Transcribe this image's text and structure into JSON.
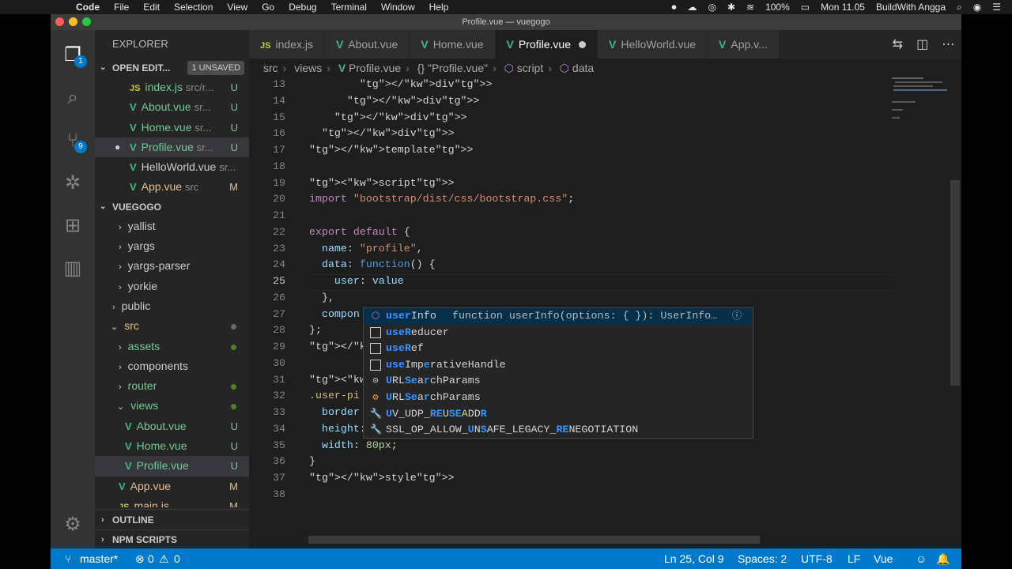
{
  "mac_menu": {
    "apple": "",
    "app_name": "Code",
    "items": [
      "File",
      "Edit",
      "Selection",
      "View",
      "Go",
      "Debug",
      "Terminal",
      "Window",
      "Help"
    ],
    "battery": "100%",
    "clock": "Mon 11.05",
    "user": "BuildWith Angga"
  },
  "window": {
    "title": "Profile.vue — vuegogo"
  },
  "activity_bar": {
    "explorer_badge": "1",
    "scm_badge": "9"
  },
  "sidebar": {
    "title": "EXPLORER",
    "open_editors": {
      "label": "OPEN EDIT...",
      "unsaved": "1 UNSAVED",
      "items": [
        {
          "icon": "JS",
          "name": "index.js",
          "path": "src/r...",
          "status": "U"
        },
        {
          "icon": "V",
          "name": "About.vue",
          "path": "sr...",
          "status": "U"
        },
        {
          "icon": "V",
          "name": "Home.vue",
          "path": "sr...",
          "status": "U"
        },
        {
          "icon": "V",
          "name": "Profile.vue",
          "path": "sr...",
          "status": "U"
        },
        {
          "icon": "V",
          "name": "HelloWorld.vue",
          "path": "sr...",
          "status": ""
        },
        {
          "icon": "V",
          "name": "App.vue",
          "path": "src",
          "status": "M"
        }
      ]
    },
    "project": {
      "label": "VUEGOGO",
      "items": [
        {
          "name": "yallist",
          "chev": "›"
        },
        {
          "name": "yargs",
          "chev": "›"
        },
        {
          "name": "yargs-parser",
          "chev": "›"
        },
        {
          "name": "yorkie",
          "chev": "›"
        },
        {
          "name": "public",
          "chev": "›"
        },
        {
          "name": "src",
          "chev": "⌄"
        },
        {
          "name": "assets",
          "chev": "›"
        },
        {
          "name": "components",
          "chev": "›"
        },
        {
          "name": "router",
          "chev": "›"
        },
        {
          "name": "views",
          "chev": "⌄"
        },
        {
          "name": "About.vue",
          "status": "U"
        },
        {
          "name": "Home.vue",
          "status": "U"
        },
        {
          "name": "Profile.vue",
          "status": "U"
        },
        {
          "name": "App.vue",
          "status": "M"
        },
        {
          "name": "main.js",
          "status": "M"
        }
      ]
    },
    "outline": "OUTLINE",
    "npm_scripts": "NPM SCRIPTS"
  },
  "tabs": [
    {
      "icon": "JS",
      "label": "index.js"
    },
    {
      "icon": "V",
      "label": "About.vue"
    },
    {
      "icon": "V",
      "label": "Home.vue"
    },
    {
      "icon": "V",
      "label": "Profile.vue"
    },
    {
      "icon": "V",
      "label": "HelloWorld.vue"
    },
    {
      "icon": "V",
      "label": "App.v..."
    }
  ],
  "breadcrumb": [
    "src",
    "views",
    "Profile.vue",
    "{} \"Profile.vue\"",
    "script",
    "data"
  ],
  "code": {
    "line_numbers": [
      "13",
      "14",
      "15",
      "16",
      "17",
      "18",
      "19",
      "20",
      "21",
      "22",
      "23",
      "24",
      "25",
      "26",
      "27",
      "28",
      "29",
      "30",
      "31",
      "32",
      "33",
      "34",
      "35",
      "36",
      "37",
      "38"
    ],
    "current_line": "25",
    "lines": [
      "        </div>",
      "      </div>",
      "    </div>",
      "  </div>",
      "</template>",
      "",
      "<script>",
      "import \"bootstrap/dist/css/bootstrap.css\";",
      "",
      "export default {",
      "  name: \"profile\",",
      "  data: function() {",
      "    user: value",
      "  },",
      "  compon",
      "};",
      "</script",
      "",
      "<style s",
      ".user-pi",
      "  border",
      "  height: 80px;",
      "  width: 80px;",
      "}",
      "</style>",
      ""
    ]
  },
  "suggest": {
    "detail": "function userInfo(options: { }): UserInfo…",
    "items": [
      "userInfo",
      "useReducer",
      "useRef",
      "useImperativeHandle",
      "URLSearchParams",
      "URLSearchParams",
      "UV_UDP_REUSEADDR",
      "SSL_OP_ALLOW_UNSAFE_LEGACY_RENEGOTIATION"
    ]
  },
  "status_bar": {
    "branch": "master*",
    "errors": "0",
    "warnings": "0",
    "position": "Ln 25, Col 9",
    "spaces": "Spaces: 2",
    "encoding": "UTF-8",
    "eol": "LF",
    "language": "Vue"
  }
}
